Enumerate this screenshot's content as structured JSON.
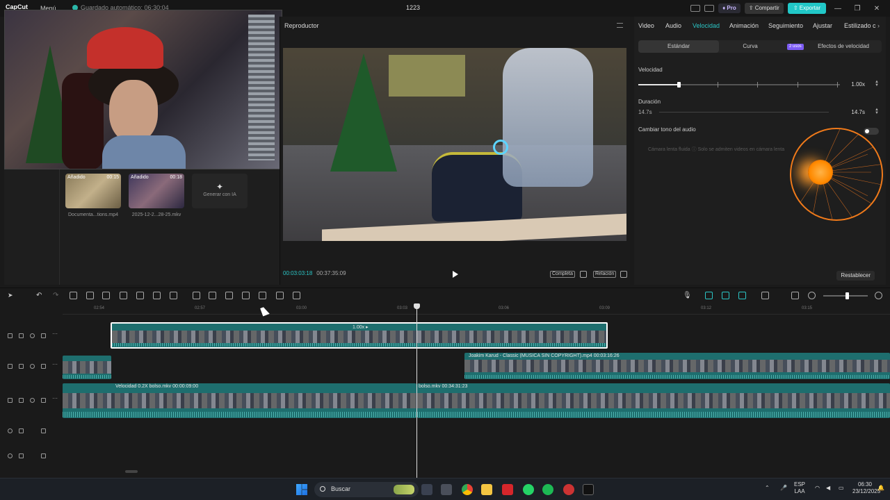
{
  "app": {
    "logo": "CapCut",
    "menu_label": "Menú",
    "autosave": "Guardado automático: 06:30:04",
    "title": "1223",
    "pro_label": "Pro",
    "share_label": "Compartir",
    "export_label": "Exportar"
  },
  "media": {
    "items": [
      {
        "tag": "Añadido",
        "duration": "00:15",
        "name": "Documenta...tions.mp4"
      },
      {
        "tag": "Añadido",
        "duration": "00:18",
        "name": "2025-12-2...28-25.mkv"
      }
    ],
    "generate_ai_label": "Generar con IA"
  },
  "player": {
    "title": "Reproductor",
    "current_time": "00:03:03:18",
    "total_time": "00:37:35:09",
    "complete_label": "Completa",
    "ratio_label": "Relación"
  },
  "props": {
    "tabs": [
      "Video",
      "Audio",
      "Velocidad",
      "Animación",
      "Seguimiento",
      "Ajustar",
      "Estilizado c"
    ],
    "active_tab": "Velocidad",
    "subtabs": [
      "Estándar",
      "Curva",
      "Efectos de velocidad"
    ],
    "badge": "2 usos",
    "speed_label": "Velocidad",
    "speed_value": "1.00x",
    "speed_slider_position": 0.2,
    "duration_label": "Duración",
    "duration_start": "14.7s",
    "duration_value": "14.7s",
    "pitch_label": "Cambiar tono del audio",
    "hint": "Cámara lenta fluida  ⓘ Solo se admiten videos en cámara lenta",
    "reset_label": "Restablecer"
  },
  "timeline": {
    "ruler": [
      "02:54",
      "02:57",
      "03:00",
      "03:03",
      "03:06",
      "03:09",
      "03:12",
      "03:15"
    ],
    "speed_tag": "1.00x ▸",
    "clips": {
      "audio_clip": "Joakim Karud - Classic    (MUSICA SIN COPYRIGHT).mp4   00:03:16:26",
      "main_left": "Velocidad 0.2X  bolso.mkv   00:00:09:00",
      "main_right": "bolso.mkv   00:34:31:23"
    },
    "zoom_level": 0.53
  },
  "taskbar": {
    "search_placeholder": "Buscar",
    "lang": "ESP",
    "lang2": "LAA",
    "time": "06:30",
    "date": "23/12/2025"
  }
}
